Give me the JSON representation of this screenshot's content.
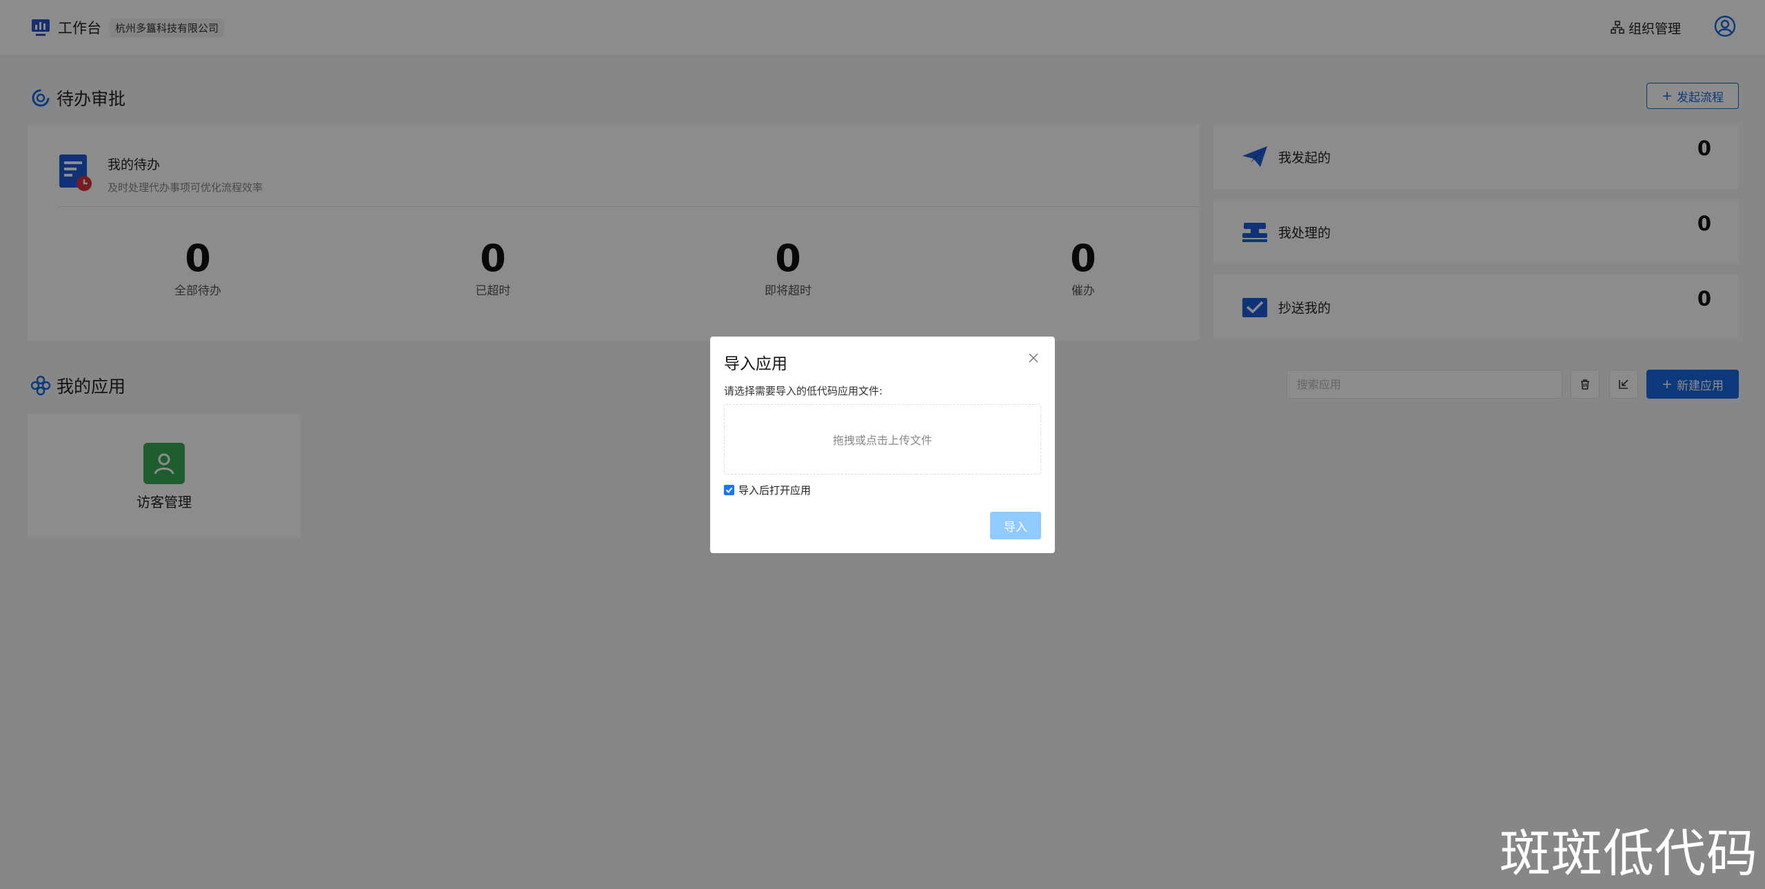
{
  "header": {
    "title": "工作台",
    "company": "杭州多簋科技有限公司",
    "org_link": "组织管理"
  },
  "pending": {
    "section_title": "待办审批",
    "start_button": "发起流程",
    "my_todo_title": "我的待办",
    "my_todo_subtitle": "及时处理代办事项可优化流程效率",
    "stats": [
      {
        "value": "0",
        "label": "全部待办"
      },
      {
        "value": "0",
        "label": "已超时"
      },
      {
        "value": "0",
        "label": "即将超时"
      },
      {
        "value": "0",
        "label": "催办"
      }
    ],
    "side": [
      {
        "label": "我发起的",
        "value": "0",
        "icon": "paper-plane-icon"
      },
      {
        "label": "我处理的",
        "value": "0",
        "icon": "stamp-icon"
      },
      {
        "label": "抄送我的",
        "value": "0",
        "icon": "checked-mail-icon"
      }
    ]
  },
  "apps": {
    "section_title": "我的应用",
    "search_placeholder": "搜索应用",
    "new_button": "新建应用",
    "items": [
      {
        "name": "访客管理",
        "icon": "user-icon",
        "color": "#3aaa55"
      }
    ]
  },
  "modal": {
    "title": "导入应用",
    "description": "请选择需要导入的低代码应用文件:",
    "dropzone_text": "拖拽或点击上传文件",
    "checkbox_label": "导入后打开应用",
    "checkbox_checked": true,
    "import_button": "导入"
  },
  "watermark": "斑斑低代码",
  "colors": {
    "primary": "#1668dc",
    "primary_disabled": "#91caff",
    "app_green": "#3aaa55"
  }
}
